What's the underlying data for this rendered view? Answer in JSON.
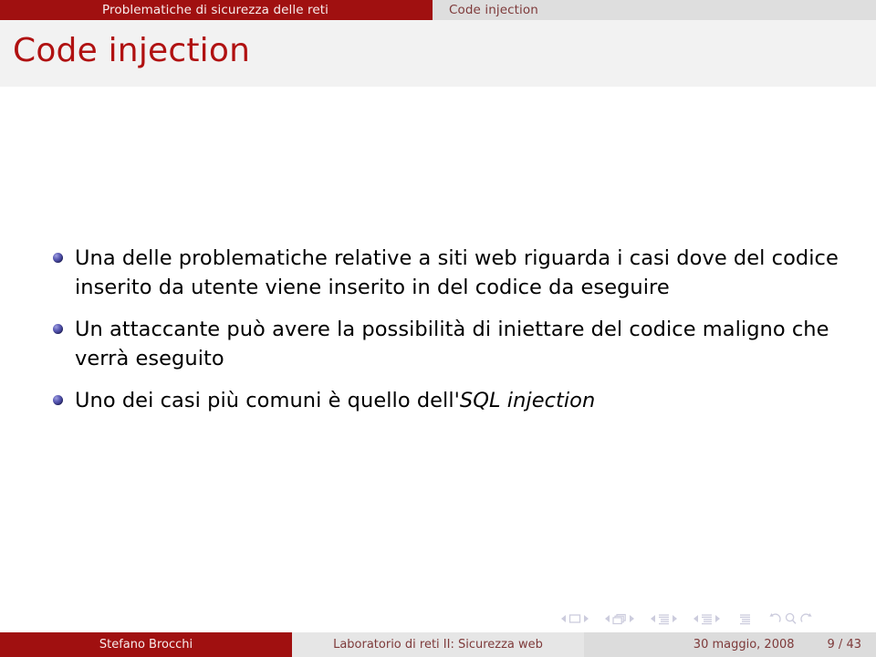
{
  "header": {
    "sections": [
      {
        "label": "Problematiche di sicurezza delle reti",
        "state": "active"
      },
      {
        "label": "Code injection",
        "state": "inactive"
      }
    ]
  },
  "title": {
    "text": "Code injection"
  },
  "content": {
    "bullets": [
      {
        "text": "Una delle problematiche relative a siti web riguarda i casi dove del codice inserito da utente viene inserito in del codice da eseguire",
        "emphasis": ""
      },
      {
        "text": "Un attaccante può avere la possibilità di iniettare del codice maligno che verrà eseguito",
        "emphasis": ""
      },
      {
        "text": "Uno dei casi più comuni è quello dell'",
        "emphasis": "SQL injection"
      }
    ]
  },
  "navigation": {
    "groups": [
      {
        "name": "slide-navigation",
        "icon": "slide-icon"
      },
      {
        "name": "frame-navigation",
        "icon": "frames-icon"
      },
      {
        "name": "subsection-navigation",
        "icon": "subsection-icon"
      },
      {
        "name": "section-navigation",
        "icon": "section-icon"
      },
      {
        "name": "presentation-navigation",
        "icon": "presentation-icon"
      },
      {
        "name": "history-navigation",
        "icon": "back-find-forward-icon"
      }
    ]
  },
  "footer": {
    "author": "Stefano Brocchi",
    "title": "Laboratorio di reti II: Sicurezza web",
    "date": "30 maggio, 2008",
    "page": "9 / 43"
  },
  "colors": {
    "primary_red": "#a01010",
    "title_red": "#b01111",
    "footer_text_red": "#7e3a3a",
    "title_band": "#f2f2f2",
    "header_inactive": "#dedede",
    "bullet_blue": "#2d2d7a",
    "nav_symbol": "#ccccdd"
  }
}
